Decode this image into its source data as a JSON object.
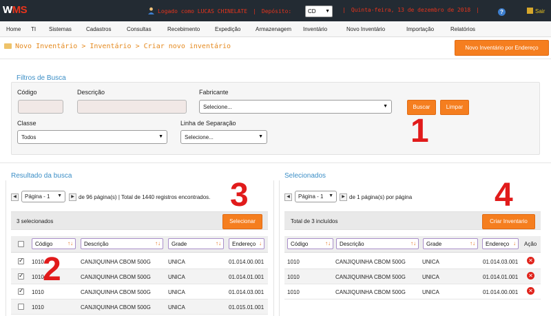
{
  "header": {
    "logo_w": "W",
    "logo_rest": "MS",
    "logged_user": "Logado como LUCAS CHINELATE",
    "deposito_label": "Depósito:",
    "deposito_value": "CD",
    "date": "Quinta-feira, 13 de dezembro de 2018",
    "help": "?",
    "exit_label": "Sair"
  },
  "menu": [
    "Home",
    "TI",
    "Sistemas",
    "Cadastros",
    "Consultas",
    "Recebimento",
    "Expedição",
    "Armazenagem",
    "Inventário",
    "Novo Inventário",
    "Importação",
    "Relatórios"
  ],
  "breadcrumb": "Novo Inventário > Inventário > Criar novo inventário",
  "actions": {
    "new_by_address": "Novo Inventário por Endereço"
  },
  "filters": {
    "title": "Filtros de Busca",
    "codigo_label": "Código",
    "descricao_label": "Descrição",
    "fabricante_label": "Fabricante",
    "fabricante_value": "Selecione...",
    "classe_label": "Classe",
    "classe_value": "Todos",
    "linha_label": "Linha de Separação",
    "linha_value": "Selecione...",
    "buscar": "Buscar",
    "limpar": "Limpar"
  },
  "annotations": [
    "1",
    "2",
    "3",
    "4"
  ],
  "results": {
    "title": "Resultado da busca",
    "page_value": "Página - 1",
    "page_info": "de 96 página(s) | Total de 1440 registros encontrados.",
    "selected_count": "3 selecionados",
    "select_button": "Selecionar",
    "columns": [
      "Código",
      "Descrição",
      "Grade",
      "Endereço"
    ],
    "rows": [
      {
        "checked": true,
        "codigo": "1010",
        "descricao": "CANJIQUINHA CBOM 500G",
        "grade": "UNICA",
        "endereco": "01.014.00.001"
      },
      {
        "checked": true,
        "codigo": "1010",
        "descricao": "CANJIQUINHA CBOM 500G",
        "grade": "UNICA",
        "endereco": "01.014.01.001"
      },
      {
        "checked": true,
        "codigo": "1010",
        "descricao": "CANJIQUINHA CBOM 500G",
        "grade": "UNICA",
        "endereco": "01.014.03.001"
      },
      {
        "checked": false,
        "codigo": "1010",
        "descricao": "CANJIQUINHA CBOM 500G",
        "grade": "UNICA",
        "endereco": "01.015.01.001"
      }
    ]
  },
  "selected": {
    "title": "Selecionados",
    "page_value": "Página - 1",
    "page_info": "de 1 página(s) por página",
    "total": "Total de 3 incluídos",
    "create_button": "Criar Inventario",
    "columns": [
      "Código",
      "Descrição",
      "Grade",
      "Endereço",
      "Ação"
    ],
    "rows": [
      {
        "codigo": "1010",
        "descricao": "CANJIQUINHA CBOM 500G",
        "grade": "UNICA",
        "endereco": "01.014.03.001"
      },
      {
        "codigo": "1010",
        "descricao": "CANJIQUINHA CBOM 500G",
        "grade": "UNICA",
        "endereco": "01.014.01.001"
      },
      {
        "codigo": "1010",
        "descricao": "CANJIQUINHA CBOM 500G",
        "grade": "UNICA",
        "endereco": "01.014.00.001"
      }
    ]
  }
}
